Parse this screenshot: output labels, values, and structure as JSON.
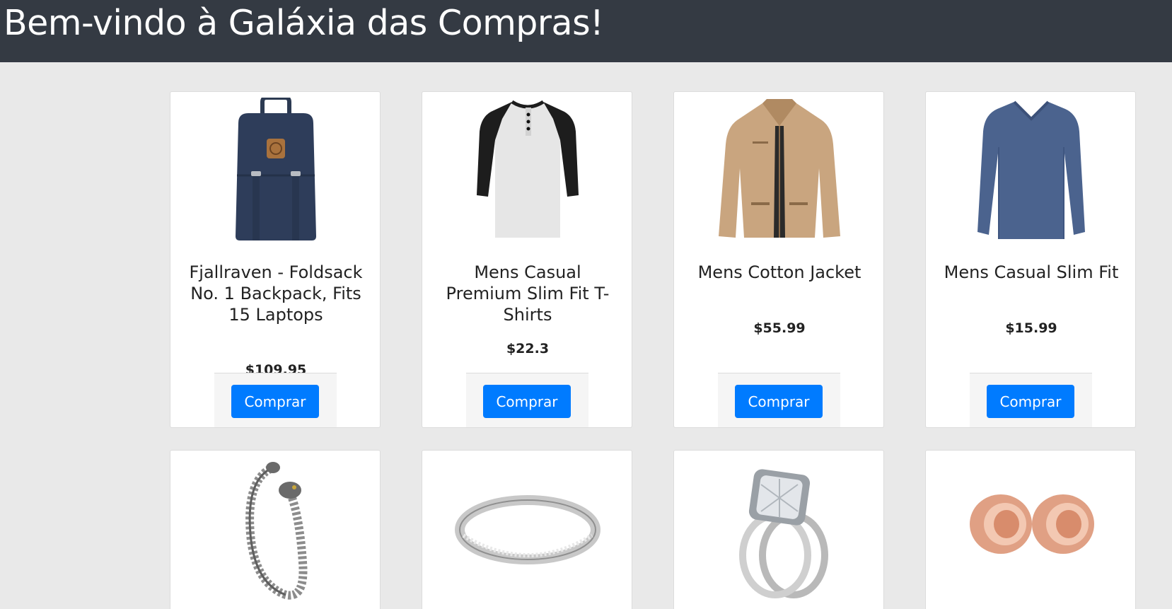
{
  "header": {
    "title": "Bem-vindo à Galáxia das Compras!"
  },
  "colors": {
    "header_bg": "#343a43",
    "page_bg": "#e9e9e9",
    "button": "#007bff"
  },
  "products": [
    {
      "title": "Fjallraven - Foldsack No. 1 Backpack, Fits 15 Laptops",
      "price": "$109.95",
      "button": "Comprar",
      "image": "backpack-image"
    },
    {
      "title": "Mens Casual Premium Slim Fit T-Shirts",
      "price": "$22.3",
      "button": "Comprar",
      "image": "raglan-tshirt-image"
    },
    {
      "title": "Mens Cotton Jacket",
      "price": "$55.99",
      "button": "Comprar",
      "image": "cotton-jacket-image"
    },
    {
      "title": "Mens Casual Slim Fit",
      "price": "$15.99",
      "button": "Comprar",
      "image": "long-sleeve-shirt-image"
    },
    {
      "image": "dragon-bracelet-image"
    },
    {
      "image": "silver-ring-image"
    },
    {
      "image": "diamond-ring-image"
    },
    {
      "image": "rose-gold-plugs-image"
    }
  ]
}
